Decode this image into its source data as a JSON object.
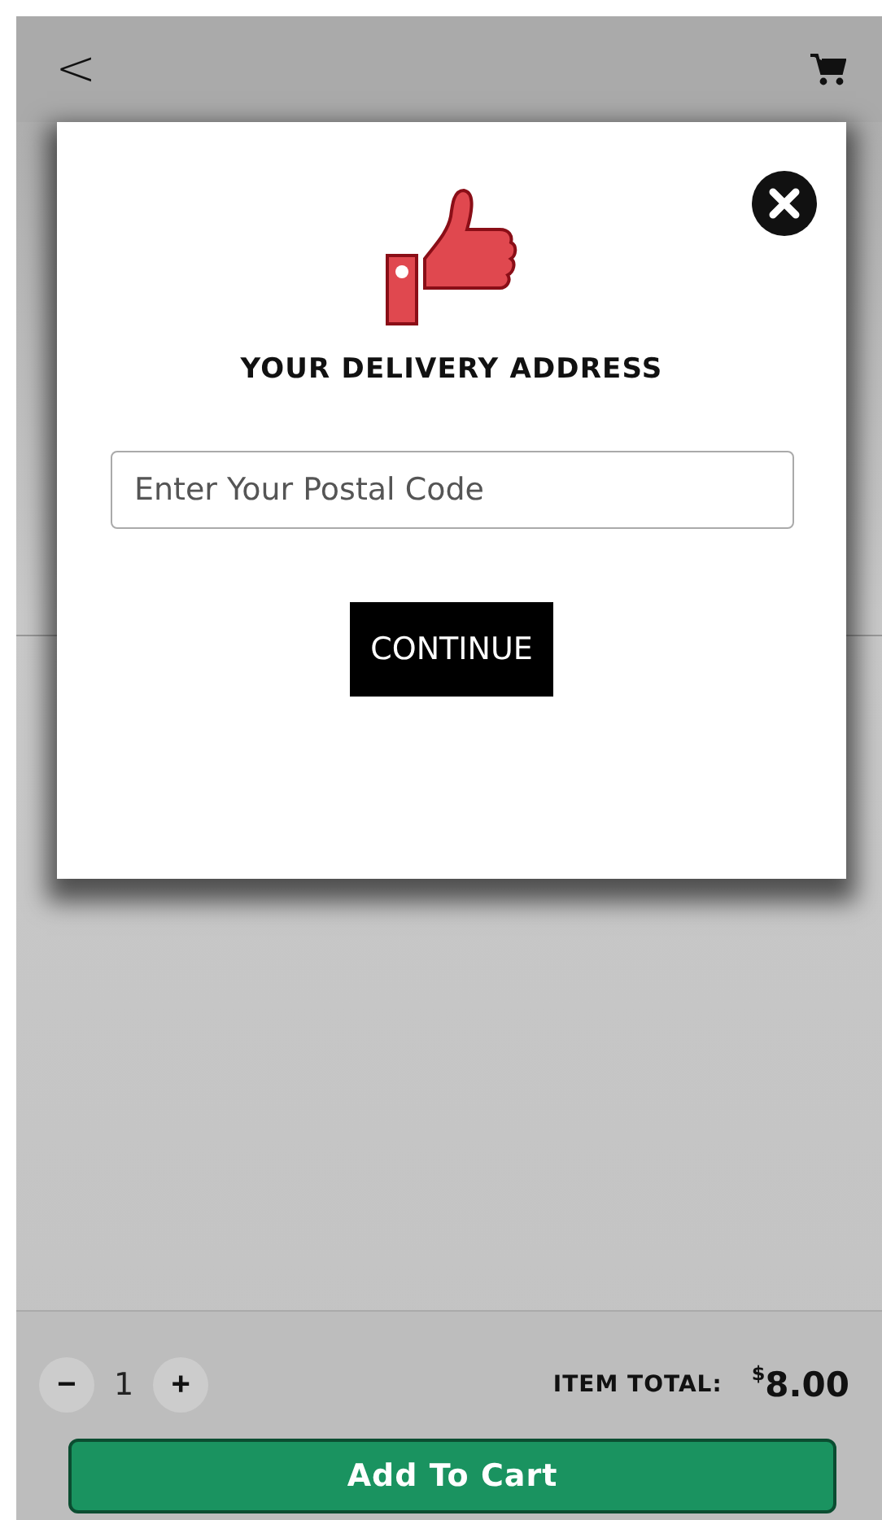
{
  "header": {
    "back": "<"
  },
  "dialog": {
    "title": "YOUR DELIVERY ADDRESS",
    "postal_code": {
      "placeholder": "Enter Your Postal Code"
    },
    "button": "CONTINUE"
  },
  "footer": {
    "quantity": "1",
    "decrease": "−",
    "increase": "+",
    "total_label": "ITEM TOTAL:",
    "currency": "$",
    "amount": "8.00",
    "add_button": "Add To Cart"
  }
}
